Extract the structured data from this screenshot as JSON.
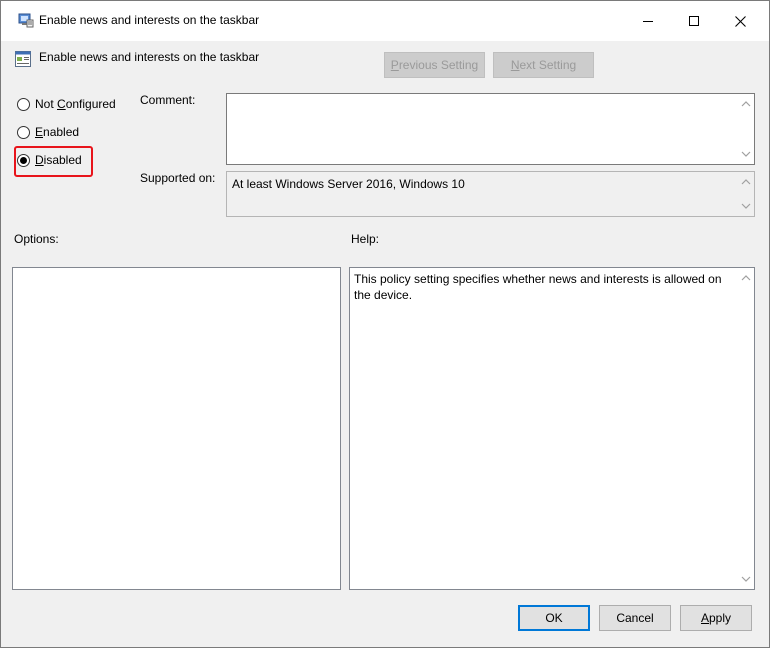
{
  "window": {
    "title": "Enable news and interests on the taskbar",
    "controls": {
      "minimize_icon": "minimize-icon",
      "maximize_icon": "maximize-icon",
      "close_icon": "close-icon"
    }
  },
  "header": {
    "policy_title": "Enable news and interests on the taskbar",
    "previous_label_u": "P",
    "previous_label_rest": "revious Setting",
    "next_label_u": "N",
    "next_label_rest": "ext Setting"
  },
  "state": {
    "options": [
      {
        "label_pre": "Not ",
        "label_u": "C",
        "label_post": "onfigured",
        "selected": false
      },
      {
        "label_pre": "",
        "label_u": "E",
        "label_post": "nabled",
        "selected": false
      },
      {
        "label_pre": "",
        "label_u": "D",
        "label_post": "isabled",
        "selected": true
      }
    ],
    "highlight_color": "#e8141b"
  },
  "comment": {
    "label": "Comment:",
    "value": ""
  },
  "supported": {
    "label": "Supported on:",
    "value": "At least Windows Server 2016, Windows 10"
  },
  "options_section": {
    "label": "Options:"
  },
  "help_section": {
    "label": "Help:",
    "text": "This policy setting specifies whether news and interests is allowed on the device."
  },
  "footer": {
    "ok_label": "OK",
    "cancel_label": "Cancel",
    "apply_label_u": "A",
    "apply_label_rest": "pply"
  },
  "colors": {
    "accent": "#0078d7",
    "window_bg": "#f0f0f0"
  }
}
